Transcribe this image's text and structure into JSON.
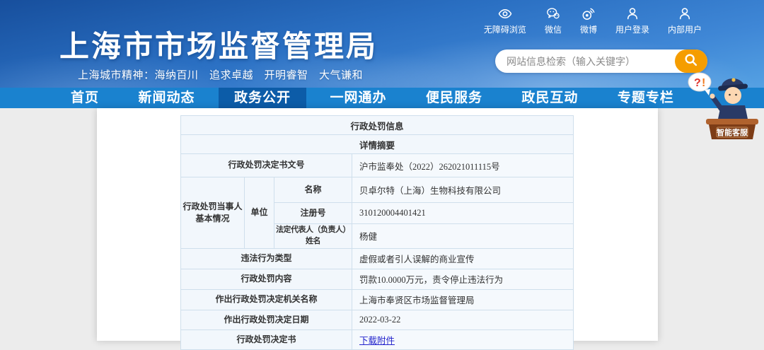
{
  "header": {
    "title": "上海市市场监督管理局",
    "motto": "上海城市精神：海纳百川　追求卓越　开明睿智　大气谦和",
    "utilities": [
      {
        "label": "无障碍浏览",
        "icon": "eye-icon"
      },
      {
        "label": "微信",
        "icon": "wechat-icon"
      },
      {
        "label": "微博",
        "icon": "weibo-icon"
      },
      {
        "label": "用户登录",
        "icon": "user-icon"
      },
      {
        "label": "内部用户",
        "icon": "user-icon"
      }
    ],
    "search": {
      "placeholder": "网站信息检索（输入关键字）",
      "value": ""
    }
  },
  "nav": {
    "items": [
      {
        "label": "首页"
      },
      {
        "label": "新闻动态"
      },
      {
        "label": "政务公开"
      },
      {
        "label": "一网通办"
      },
      {
        "label": "便民服务"
      },
      {
        "label": "政民互动"
      },
      {
        "label": "专题专栏"
      }
    ],
    "active": "政务公开"
  },
  "mascot": {
    "bubble_q": "?",
    "bubble_ex": "!",
    "desk_label": "智能客服"
  },
  "table": {
    "title": "行政处罚信息",
    "subtitle": "详情摘要",
    "doc_no": {
      "label": "行政处罚决定书文号",
      "value": "沪市监奉处（2022）262021011115号"
    },
    "party": {
      "label": "行政处罚当事人\n基本情况",
      "type": "单位",
      "fields": [
        {
          "label": "名称",
          "value": "贝卓尔特（上海）生物科技有限公司"
        },
        {
          "label": "注册号",
          "value": "310120004401421"
        },
        {
          "label": "法定代表人（负责人）\n姓名",
          "value": "杨健"
        }
      ]
    },
    "rows": [
      {
        "label": "违法行为类型",
        "value": "虚假或者引人误解的商业宣传"
      },
      {
        "label": "行政处罚内容",
        "value": "罚款10.0000万元，责令停止违法行为"
      },
      {
        "label": "作出行政处罚决定机关名称",
        "value": "上海市奉贤区市场监督管理局"
      },
      {
        "label": "作出行政处罚决定日期",
        "value": "2022-03-22"
      },
      {
        "label": "行政处罚决定书",
        "link_text": "下载附件"
      }
    ]
  },
  "colors": {
    "header_gradient_top": "#174f9d",
    "header_gradient_bottom": "#55a1e3",
    "nav_blue": "#1a82cf",
    "nav_active_blue": "#0c5ca8",
    "search_button_orange": "#f59d00",
    "table_border": "#cfdfec",
    "table_cell_bg": "#f2f7fc",
    "link_blue": "#2323cc"
  }
}
